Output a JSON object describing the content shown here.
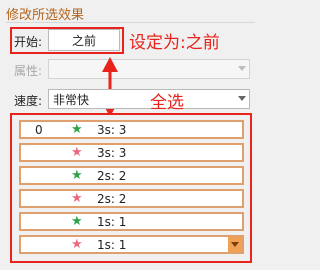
{
  "panel": {
    "section_title": "修改所选效果"
  },
  "start": {
    "label": "开始:",
    "value": "之前"
  },
  "property": {
    "label": "属性:",
    "value": ""
  },
  "speed": {
    "label": "速度:",
    "value": "非常快"
  },
  "annotations": {
    "set_to_before": "设定为:之前",
    "select_all": "全选",
    "color": "#e8231b"
  },
  "animation_list": {
    "items": [
      {
        "index": "0",
        "icon": "green-entrance-star-icon",
        "label": "3s: 3"
      },
      {
        "index": "",
        "icon": "pink-exit-star-icon",
        "label": "3s: 3"
      },
      {
        "index": "",
        "icon": "green-entrance-star-icon",
        "label": "2s: 2"
      },
      {
        "index": "",
        "icon": "pink-exit-star-icon",
        "label": "2s: 2"
      },
      {
        "index": "",
        "icon": "green-entrance-star-icon",
        "label": "1s: 1"
      },
      {
        "index": "",
        "icon": "pink-exit-star-icon",
        "label": "1s: 1"
      }
    ],
    "item_border_color": "#e0a06e"
  }
}
